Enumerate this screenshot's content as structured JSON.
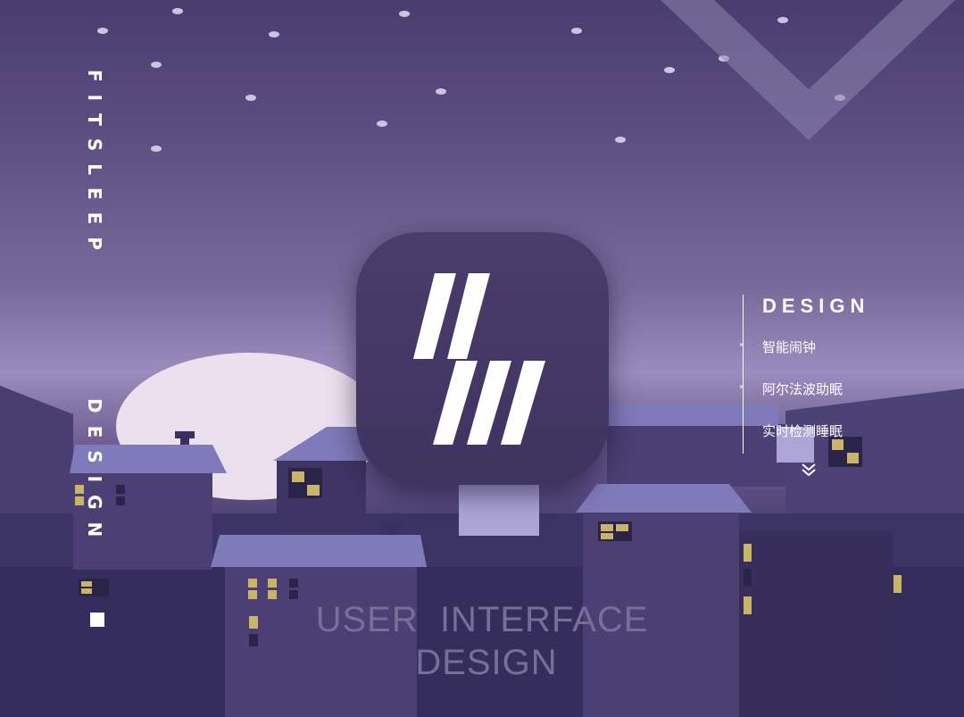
{
  "side_title_top": "FITSLEEP",
  "side_title_bottom": "DESIGN",
  "design_panel": {
    "title": "DESIGN",
    "items": [
      "智能闹钟",
      "阿尔法波助眠",
      "实时检测睡眠"
    ],
    "bullet": "×",
    "more_icon": "double-chevron-down-icon"
  },
  "bottom_title": {
    "line1": "USER  INTERFACE",
    "line2": "DESIGN"
  },
  "colors": {
    "sky_top": "#4a3d6e",
    "moon": "#ece0ee",
    "roof": "#7f7ab9",
    "window_lit": "#c9b46a",
    "icon_bg": "#433664",
    "bottom_text": "#776f99"
  }
}
